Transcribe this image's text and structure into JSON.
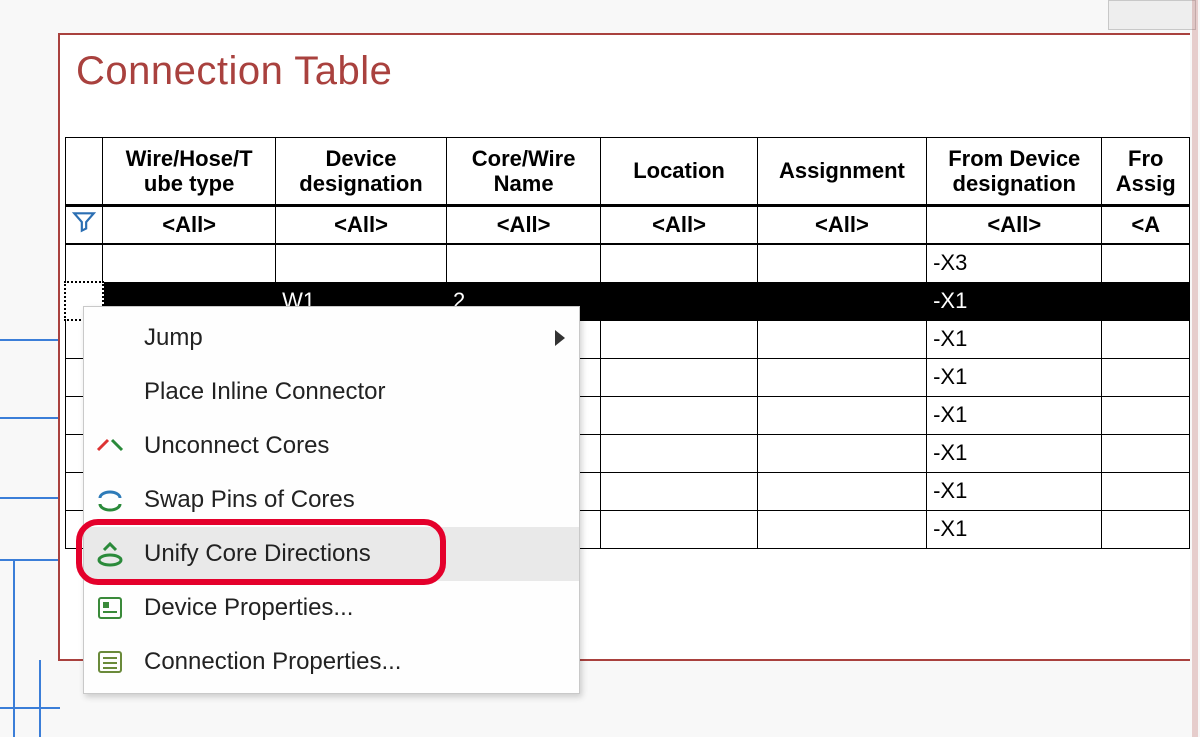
{
  "panel": {
    "title": "Connection Table"
  },
  "table": {
    "columns": [
      {
        "line1": "Wire/Hose/T",
        "line2": "ube type"
      },
      {
        "line1": "Device",
        "line2": "designation"
      },
      {
        "line1": "Core/Wire",
        "line2": "Name"
      },
      {
        "line1": "Location",
        "line2": ""
      },
      {
        "line1": "Assignment",
        "line2": ""
      },
      {
        "line1": "From Device",
        "line2": "designation"
      },
      {
        "line1": "Fro",
        "line2": "Assig"
      }
    ],
    "filter_value": "<All>",
    "filter_value_cut": "<A",
    "rows": [
      {
        "c1": "",
        "c2": "",
        "c3": "",
        "c6": "-X3",
        "selected": false
      },
      {
        "c1": "",
        "c2": "W1",
        "c3": "2",
        "c6": "-X1",
        "selected": true
      },
      {
        "c6": "-X1"
      },
      {
        "c6": "-X1"
      },
      {
        "c6": "-X1"
      },
      {
        "c6": "-X1"
      },
      {
        "c6": "-X1"
      },
      {
        "c6": "-X1"
      }
    ]
  },
  "context_menu": {
    "items": [
      {
        "key": "jump",
        "label": "Jump",
        "submenu": true,
        "highlight": false
      },
      {
        "key": "place-inline",
        "label": "Place Inline Connector",
        "submenu": false,
        "highlight": false
      },
      {
        "key": "unconnect",
        "label": "Unconnect Cores",
        "submenu": false,
        "highlight": false
      },
      {
        "key": "swap-pins",
        "label": "Swap Pins of Cores",
        "submenu": false,
        "highlight": false
      },
      {
        "key": "unify",
        "label": "Unify Core Directions",
        "submenu": false,
        "highlight": true
      },
      {
        "key": "dev-props",
        "label": "Device Properties...",
        "submenu": false,
        "highlight": false
      },
      {
        "key": "conn-props",
        "label": "Connection Properties...",
        "submenu": false,
        "highlight": false
      }
    ]
  }
}
